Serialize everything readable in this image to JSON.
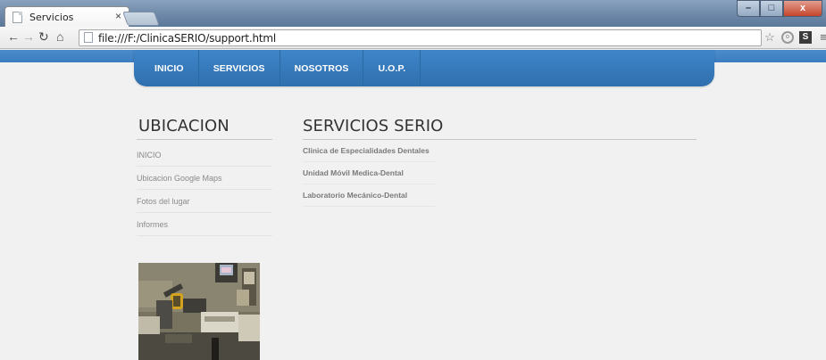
{
  "browser": {
    "tab_title": "Servicios",
    "tab_close": "×",
    "url": "file:///F:/ClinicaSERIO/support.html",
    "window_buttons": {
      "minimize": "–",
      "maximize": "□",
      "close": "x"
    }
  },
  "nav": {
    "menu": [
      {
        "label": "INICIO"
      },
      {
        "label": "SERVICIOS"
      },
      {
        "label": "NOSOTROS"
      },
      {
        "label": "U.O.P."
      }
    ],
    "color": "#3478bb"
  },
  "sidebar": {
    "heading": "UBICACION",
    "items": [
      {
        "label": "INICIO"
      },
      {
        "label": "Ubicacion Google Maps"
      },
      {
        "label": "Fotos del lugar"
      },
      {
        "label": "Informes"
      }
    ]
  },
  "main": {
    "heading": "SERVICIOS SERIO",
    "items": [
      {
        "label": "Clinica de Especialidades Dentales"
      },
      {
        "label": "Unidad Móvil Medica-Dental"
      },
      {
        "label": "Laboratorio Mecánico-Dental"
      }
    ]
  },
  "icons": {
    "back": "back-arrow-icon",
    "forward": "forward-arrow-icon",
    "reload": "reload-icon",
    "home": "home-icon",
    "star": "star-icon",
    "menu": "menu-icon"
  }
}
